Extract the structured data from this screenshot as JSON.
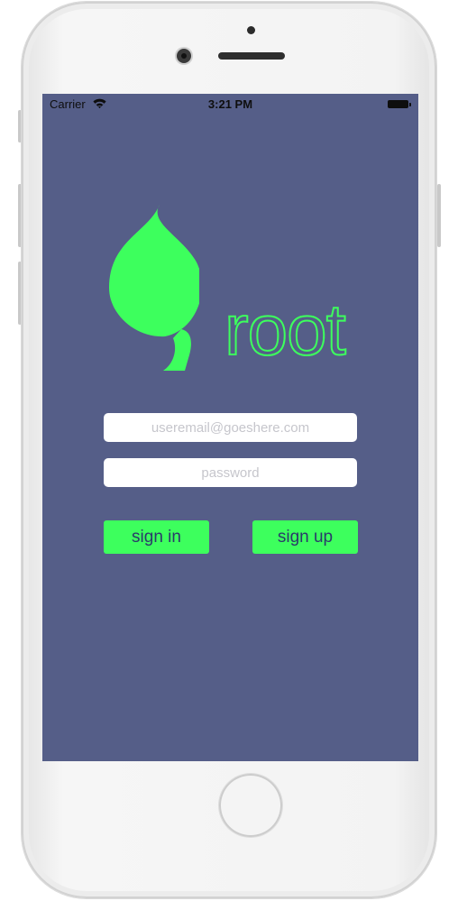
{
  "status_bar": {
    "carrier": "Carrier",
    "time": "3:21 PM",
    "wifi_icon": "wifi-icon",
    "battery_icon": "battery-icon"
  },
  "logo": {
    "icon": "leaf-icon",
    "text": "root"
  },
  "login_form": {
    "email_placeholder": "useremail@goeshere.com",
    "email_value": "",
    "password_placeholder": "password",
    "password_value": ""
  },
  "buttons": {
    "sign_in_label": "sign in",
    "sign_up_label": "sign up"
  },
  "colors": {
    "screen_background": "#555e88",
    "accent_green": "#3dff5d",
    "button_text": "#2a3a6a"
  }
}
